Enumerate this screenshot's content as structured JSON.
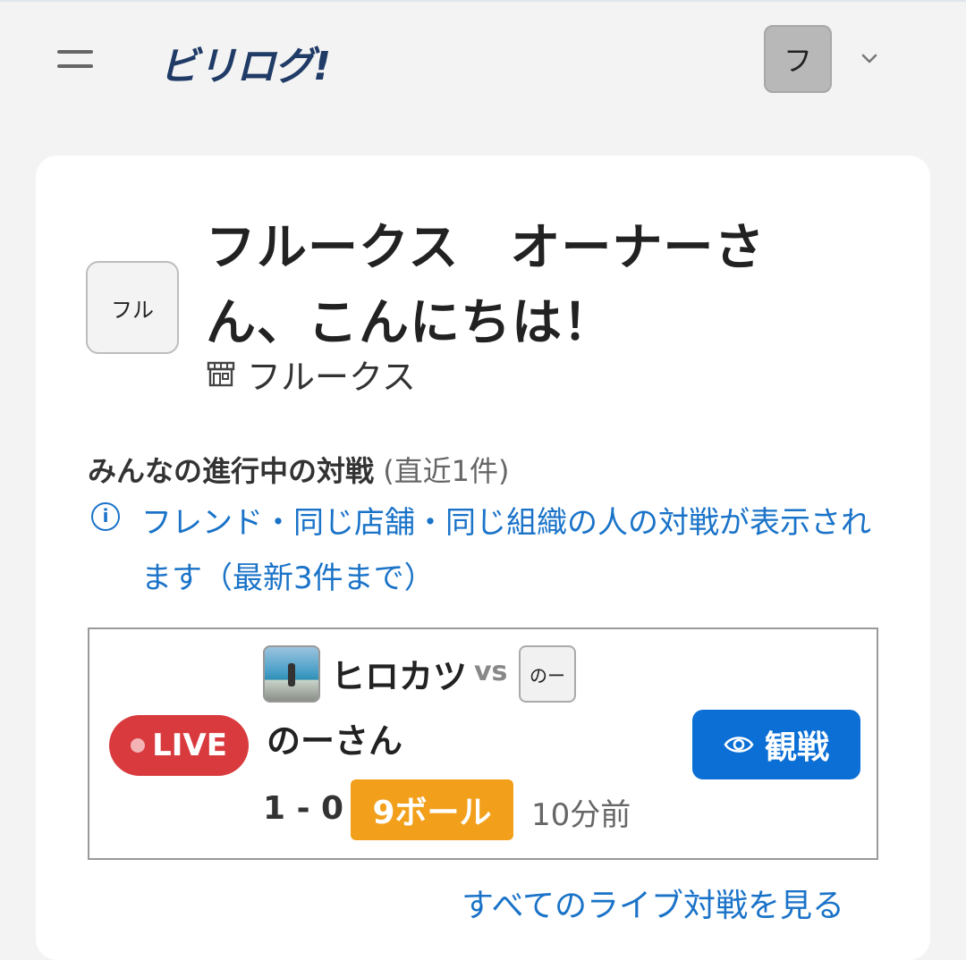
{
  "header": {
    "logo": "ビリログ!",
    "user_initial": "フ"
  },
  "card": {
    "store_avatar_text": "フル",
    "greeting": "フルークス　オーナーさん、こんにちは！",
    "store_name": "フルークス",
    "section_title": "みんなの進行中の対戦",
    "section_sub": "(直近1件)",
    "info_text": "フレンド・同じ店舗・同じ組織の人の対戦が表示されます（最新3件まで）",
    "match": {
      "live_label": "LIVE",
      "player1": "ヒロカツ",
      "vs": "vs",
      "player2_avatar_text": "のー",
      "player2": "のーさん",
      "score": "1 - 0",
      "game": "9ボール",
      "time_ago": "10分前",
      "watch_label": "観戦"
    },
    "see_all_link": "すべてのライブ対戦を見る"
  },
  "colors": {
    "logo": "#1f3b66",
    "live": "#d93a3e",
    "game_badge": "#f2a01b",
    "primary_button": "#0b6fd6",
    "link": "#1a73c8"
  },
  "icons": [
    "menu-icon",
    "chevron-down-icon",
    "store-icon",
    "info-icon",
    "eye-icon"
  ]
}
